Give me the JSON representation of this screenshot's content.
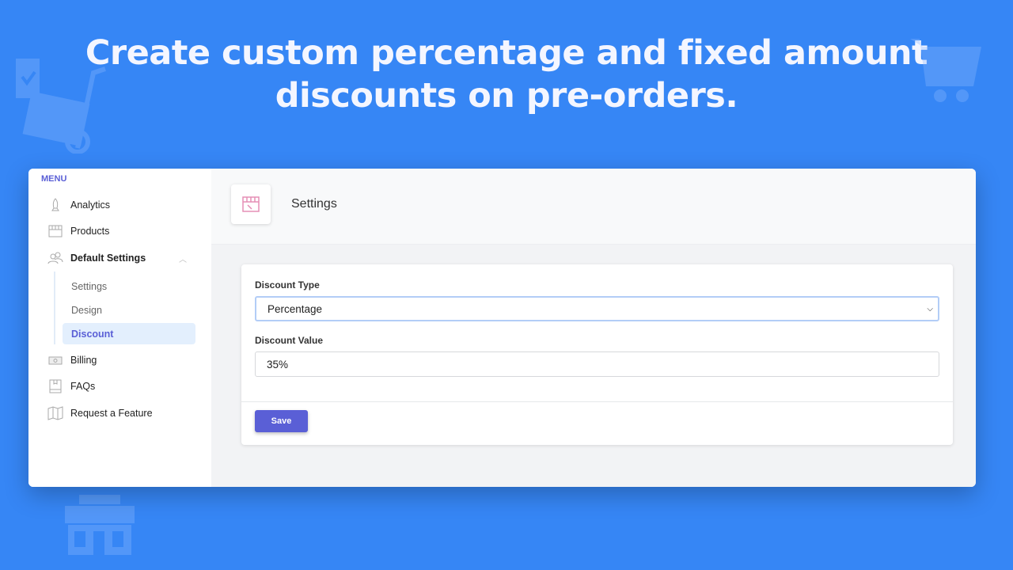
{
  "headline": {
    "line1": "Create custom percentage and fixed amount",
    "line2": "discounts on pre-orders."
  },
  "sidebar": {
    "menu_label": "MENU",
    "items": [
      {
        "label": "Analytics",
        "icon": "rocket-icon"
      },
      {
        "label": "Products",
        "icon": "store-icon"
      },
      {
        "label": "Default Settings",
        "icon": "users-icon"
      },
      {
        "label": "Billing",
        "icon": "money-icon"
      },
      {
        "label": "FAQs",
        "icon": "book-icon"
      },
      {
        "label": "Request a Feature",
        "icon": "map-icon"
      }
    ],
    "subitems": [
      {
        "label": "Settings"
      },
      {
        "label": "Design"
      },
      {
        "label": "Discount"
      }
    ]
  },
  "page": {
    "title": "Settings"
  },
  "form": {
    "discount_type_label": "Discount Type",
    "discount_type_value": "Percentage",
    "discount_value_label": "Discount Value",
    "discount_value": "35%",
    "save_label": "Save"
  },
  "colors": {
    "background": "#3686f5",
    "accent": "#5a5fd6",
    "active_bg": "#e3effd"
  }
}
